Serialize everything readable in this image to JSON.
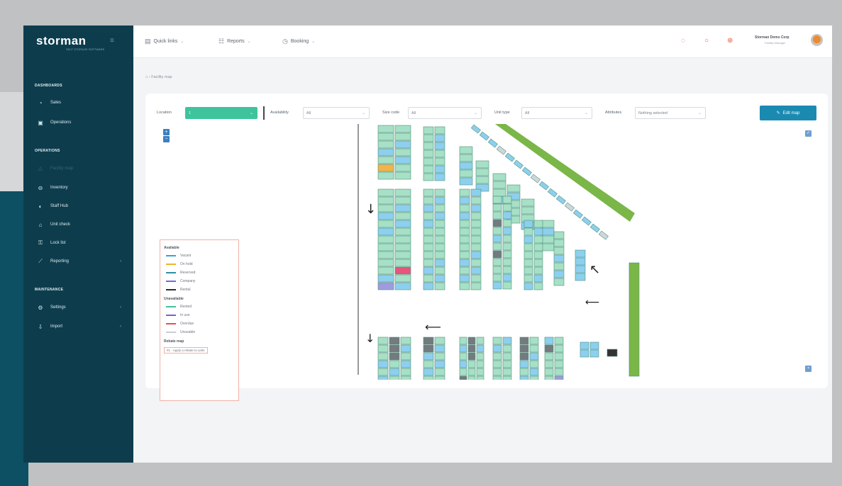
{
  "app": {
    "logo": "storman",
    "logo_sub": "SELF STORAGE SOFTWARE"
  },
  "sidebar": {
    "sections": [
      {
        "title": "DASHBOARDS"
      },
      {
        "title": "OPERATIONS"
      },
      {
        "title": "MAINTENANCE"
      }
    ],
    "items": [
      {
        "label": "Sales",
        "icon": "gauge-icon"
      },
      {
        "label": "Operations",
        "icon": "calendar-icon"
      },
      {
        "label": "Facility map",
        "icon": "map-icon",
        "active": true
      },
      {
        "label": "Inventory",
        "icon": "archive-icon"
      },
      {
        "label": "Staff Hub",
        "icon": "people-icon"
      },
      {
        "label": "Unit check",
        "icon": "checklist-icon"
      },
      {
        "label": "Lock list",
        "icon": "lock-icon"
      },
      {
        "label": "Reporting",
        "icon": "chart-icon"
      },
      {
        "label": "Settings",
        "icon": "gear-icon"
      },
      {
        "label": "Import",
        "icon": "import-icon"
      }
    ]
  },
  "topbar": {
    "quick_links": "Quick links",
    "reports": "Reports",
    "booking": "Booking",
    "user_name": "Storman Demo Corp",
    "user_role": "Facility Manager"
  },
  "breadcrumb": "Facility map",
  "filters": {
    "location_label": "Location",
    "location_value": "1",
    "availability_label": "Availability",
    "availability_value": "All",
    "size_label": "Size code",
    "size_value": "All",
    "unit_type_label": "Unit type",
    "unit_type_value": "All",
    "attributes_label": "Attributes",
    "attributes_placeholder": "Nothing selected"
  },
  "edit_map_label": "Edit map",
  "legend": {
    "availability_title": "Available",
    "availability": [
      {
        "label": "Vacant",
        "color": "#3b9fd1"
      },
      {
        "label": "On hold",
        "color": "#f0b429"
      },
      {
        "label": "Reserved",
        "color": "#2e8fa3"
      },
      {
        "label": "Company",
        "color": "#6b6fd1"
      },
      {
        "label": "Rental",
        "color": "#2b2f33"
      }
    ],
    "unavailable_title": "Unavailable",
    "unavailable": [
      {
        "label": "Rented",
        "color": "#3ec49c"
      },
      {
        "label": "In use",
        "color": "#7b62c4"
      },
      {
        "label": "Overdue",
        "color": "#e5504f"
      },
      {
        "label": "Unusable",
        "color": "#c8cdd2"
      }
    ],
    "rebate_title": "Rebate map",
    "rebate_label": "Apply a rebate to units"
  },
  "colors": {
    "green": "#a6e0c6",
    "blue": "#8dcfee",
    "darkgrey": "#747a80",
    "purple": "#9f9be0",
    "red": "#e4577b",
    "orange": "#f1b44a",
    "strip": "#7ab648"
  }
}
